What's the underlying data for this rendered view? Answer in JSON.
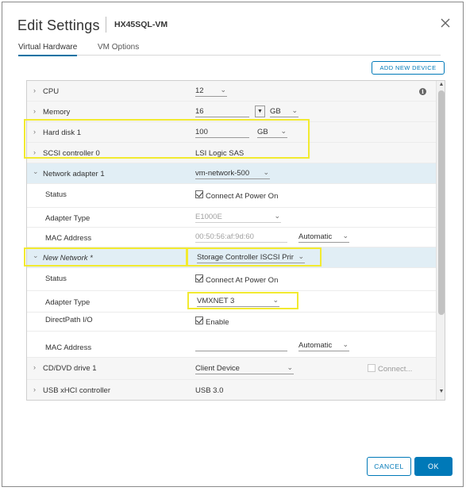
{
  "dialog": {
    "title": "Edit Settings",
    "vm_name": "HX45SQL-VM",
    "tabs": [
      {
        "label": "Virtual Hardware",
        "active": true
      },
      {
        "label": "VM Options",
        "active": false
      }
    ],
    "add_device_label": "ADD NEW DEVICE",
    "cancel_label": "CANCEL",
    "ok_label": "OK"
  },
  "hardware": {
    "cpu": {
      "label": "CPU",
      "value": "12"
    },
    "memory": {
      "label": "Memory",
      "value": "16",
      "unit": "GB"
    },
    "hard_disk": {
      "label": "Hard disk 1",
      "value": "100",
      "unit": "GB"
    },
    "scsi": {
      "label": "SCSI controller 0",
      "value": "LSI Logic SAS"
    },
    "net1": {
      "label": "Network adapter 1",
      "network": "vm-network-500",
      "status_label": "Status",
      "status_value": "Connect At Power On",
      "status_checked": true,
      "adapter_type_label": "Adapter Type",
      "adapter_type_value": "E1000E",
      "mac_label": "MAC Address",
      "mac_value": "00:50:56:af:9d:60",
      "mac_mode": "Automatic"
    },
    "net2": {
      "label": "New Network *",
      "network": "Storage Controller ISCSI Prir",
      "status_label": "Status",
      "status_value": "Connect At Power On",
      "status_checked": true,
      "adapter_type_label": "Adapter Type",
      "adapter_type_value": "VMXNET 3",
      "directpath_label": "DirectPath I/O",
      "directpath_value": "Enable",
      "directpath_checked": true,
      "mac_label": "MAC Address",
      "mac_value": "",
      "mac_mode": "Automatic"
    },
    "cdrom": {
      "label": "CD/DVD drive 1",
      "value": "Client Device",
      "connect_label": "Connect..."
    },
    "usb": {
      "label": "USB xHCI controller",
      "value": "USB 3.0"
    }
  },
  "icons": {
    "expand_collapsed": "›",
    "expand_open": "⌄",
    "dropdown": "⌄",
    "spinner_down": "▼",
    "info": "i",
    "scroll_up": "▲",
    "scroll_down": "▼"
  },
  "colors": {
    "accent": "#0079b8",
    "highlight_row": "#e1eef5",
    "annotation": "#f2ea30"
  }
}
